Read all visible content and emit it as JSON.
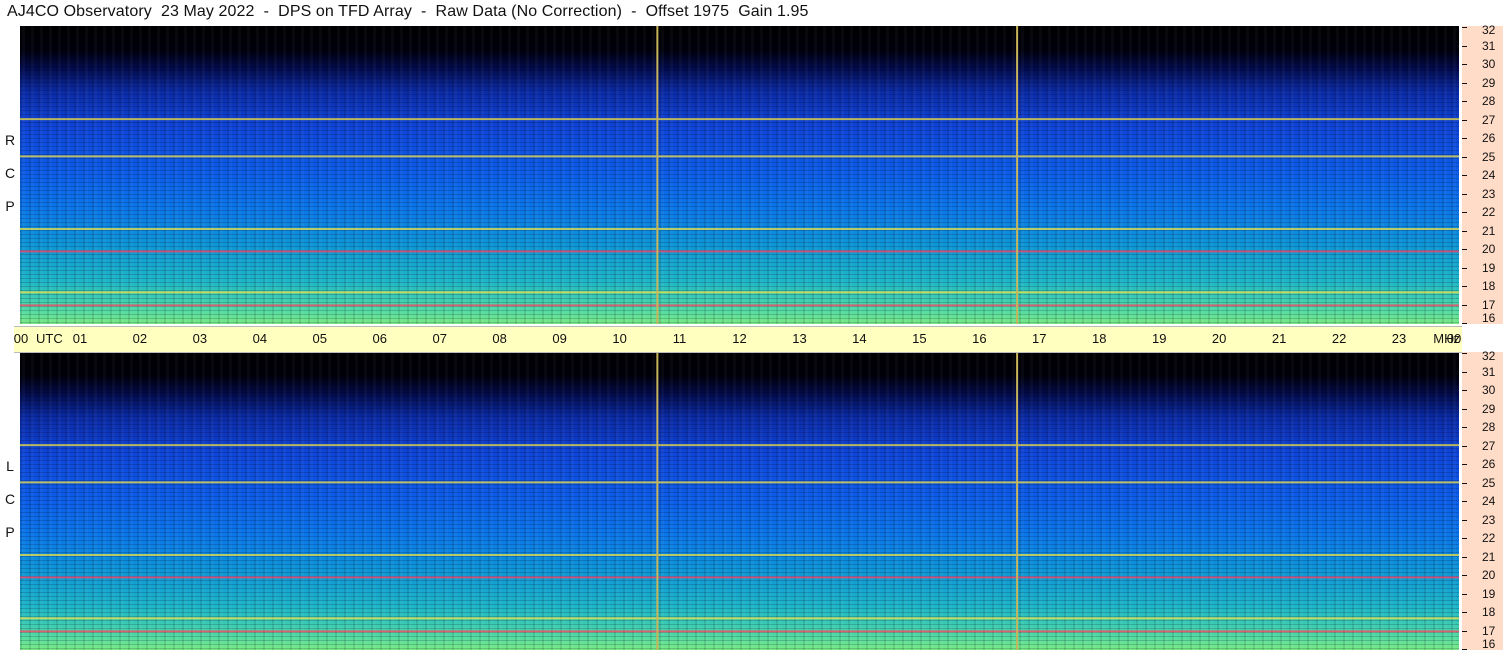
{
  "title": "AJ4CO Observatory  23 May 2022  -  DPS on TFD Array  -  Raw Data (No Correction)  -  Offset 1975  Gain 1.95",
  "panels": [
    {
      "polarization_letters": [
        "R",
        "C",
        "P"
      ]
    },
    {
      "polarization_letters": [
        "L",
        "C",
        "P"
      ]
    }
  ],
  "time_axis": {
    "unit_label": "UTC",
    "end_unit_label": "MHz",
    "tick_labels": [
      "00",
      "01",
      "02",
      "03",
      "04",
      "05",
      "06",
      "07",
      "08",
      "09",
      "10",
      "11",
      "12",
      "13",
      "14",
      "15",
      "16",
      "17",
      "18",
      "19",
      "20",
      "21",
      "22",
      "23",
      "00"
    ]
  },
  "freq_axis": {
    "tick_labels": [
      "32",
      "31",
      "30",
      "29",
      "28",
      "27",
      "26",
      "25",
      "24",
      "23",
      "22",
      "21",
      "20",
      "19",
      "18",
      "17",
      "16"
    ]
  },
  "colors": {
    "marker_line": "#c8b45a",
    "axis_band_time": "#ffffc0",
    "axis_band_freq": "#ffdcc8",
    "interference_hot": "#ff4060",
    "interference_warm": "#f0e040"
  },
  "chart_data": {
    "type": "heatmap",
    "description_of_axes": "spectrogram",
    "x_unit": "UTC hour",
    "xlim": [
      0,
      24
    ],
    "y_unit": "MHz",
    "ylim": [
      16,
      32
    ],
    "vertical_marker_hours": [
      10.63,
      16.63
    ],
    "interference_bands_mhz": [
      {
        "freq": 17.0,
        "color_class": "hot"
      },
      {
        "freq": 17.7,
        "color_class": "warm"
      },
      {
        "freq": 19.9,
        "color_class": "hot"
      },
      {
        "freq": 21.1,
        "color_class": "warm"
      },
      {
        "freq": 25.0,
        "color_class": "warm"
      },
      {
        "freq": 27.0,
        "color_class": "warm"
      }
    ]
  }
}
